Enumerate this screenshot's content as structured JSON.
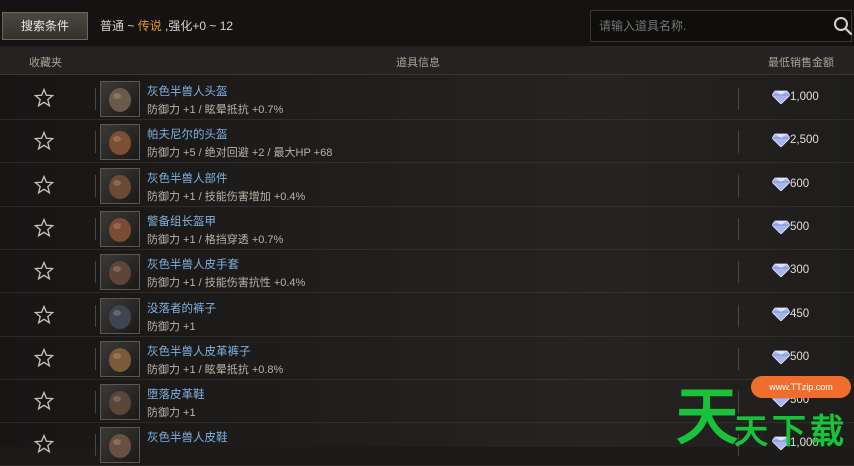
{
  "toolbar": {
    "search_button_label": "搜索条件",
    "filter_prefix": "普通 ~ ",
    "filter_legend": "传说",
    "filter_suffix": " ,强化+0 ~ 12",
    "search_placeholder": "请输入道具名称."
  },
  "columns": {
    "favorite": "收藏夹",
    "item_info": "道具信息",
    "min_price": "最低销售金额"
  },
  "items": [
    {
      "name": "灰色半兽人头盔",
      "stats": "防御力 +1 / 眩晕抵抗 +0.7%",
      "price": "1,000"
    },
    {
      "name": "帕夫尼尔的头盔",
      "stats": "防御力 +5 / 绝对回避 +2 / 最大HP +68",
      "price": "2,500"
    },
    {
      "name": "灰色半兽人部件",
      "stats": "防御力 +1 / 技能伤害增加 +0.4%",
      "price": "600"
    },
    {
      "name": "警备组长盔甲",
      "stats": "防御力 +1 / 格挡穿透 +0.7%",
      "price": "500"
    },
    {
      "name": "灰色半兽人皮手套",
      "stats": "防御力 +1 / 技能伤害抗性 +0.4%",
      "price": "300"
    },
    {
      "name": "没落者的裤子",
      "stats": "防御力 +1",
      "price": "450"
    },
    {
      "name": "灰色半兽人皮革裤子",
      "stats": "防御力 +1 / 眩晕抵抗 +0.8%",
      "price": "500"
    },
    {
      "name": "堕落皮革鞋",
      "stats": "防御力 +1",
      "price": "500"
    },
    {
      "name": "灰色半兽人皮鞋",
      "stats": "",
      "price": "1,000"
    }
  ],
  "watermark": {
    "chars": [
      "天",
      "天",
      "下",
      "载"
    ],
    "url": "www.TTzip.com"
  },
  "colors": {
    "item_name": "#7fb0e0",
    "legend_grade": "#e4952e",
    "watermark_green": "#19c23b",
    "watermark_orange": "#f06e2c"
  }
}
